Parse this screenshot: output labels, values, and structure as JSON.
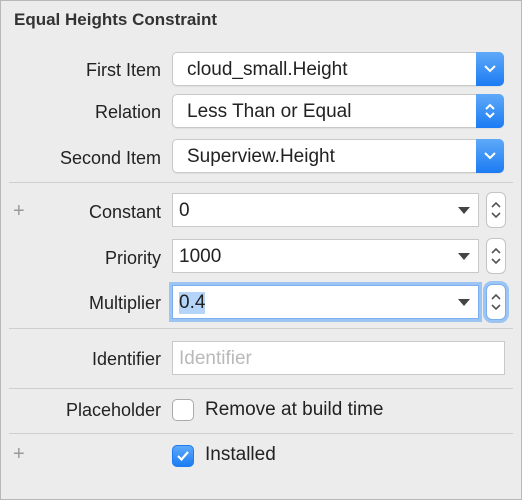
{
  "panel": {
    "title": "Equal Heights Constraint"
  },
  "first_item": {
    "label": "First Item",
    "value": "cloud_small.Height"
  },
  "relation": {
    "label": "Relation",
    "value": "Less Than or Equal"
  },
  "second_item": {
    "label": "Second Item",
    "value": "Superview.Height"
  },
  "constant": {
    "label": "Constant",
    "value": "0"
  },
  "priority": {
    "label": "Priority",
    "value": "1000"
  },
  "multiplier": {
    "label": "Multiplier",
    "value": "0.4"
  },
  "identifier": {
    "label": "Identifier",
    "value": "",
    "placeholder": "Identifier"
  },
  "placeholder_row": {
    "label": "Placeholder",
    "checkbox_label": "Remove at build time",
    "checked": false
  },
  "installed": {
    "checkbox_label": "Installed",
    "checked": true
  },
  "icons": {
    "add": "+"
  },
  "colors": {
    "accent": "#1c7cf3",
    "focus_ring": "#9cc5f4",
    "selection": "#b4d4f9"
  }
}
